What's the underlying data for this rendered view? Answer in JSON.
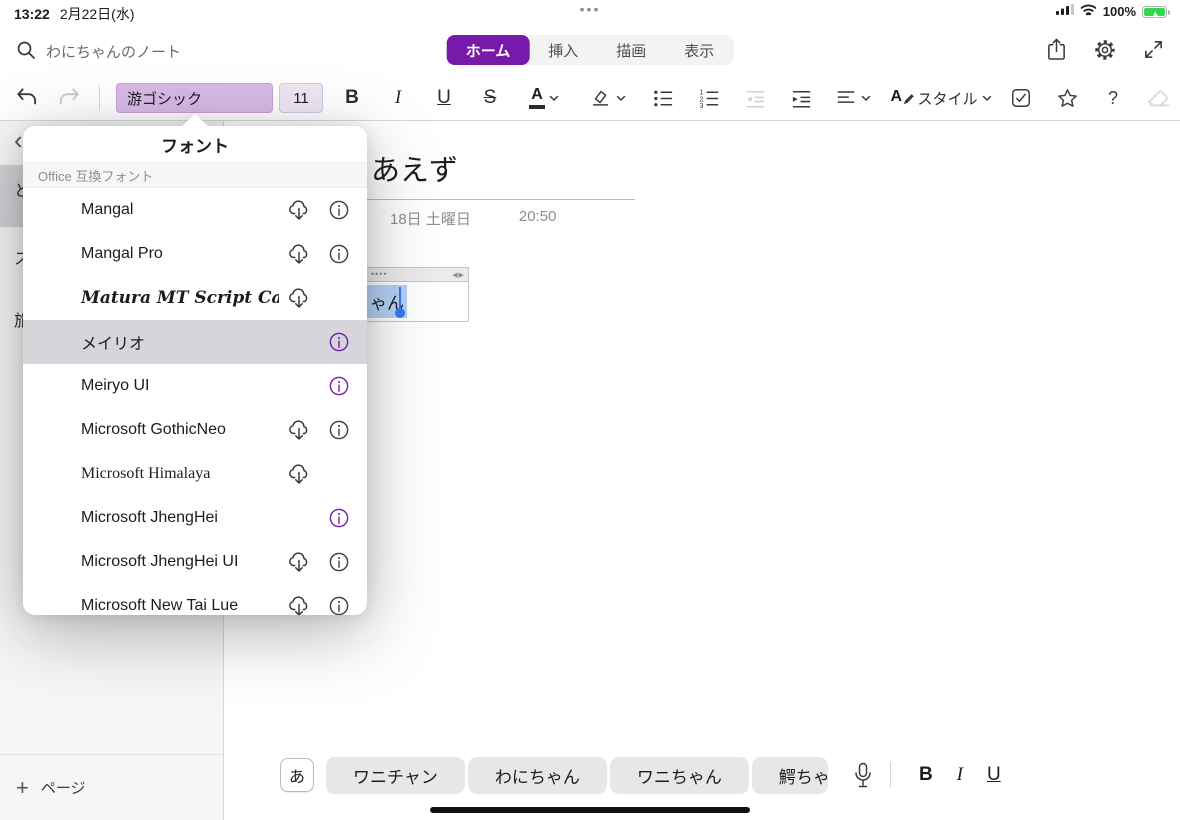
{
  "colors": {
    "accent": "#7719aa",
    "selection_blue": "#3478f6",
    "battery_green": "#32d74b"
  },
  "status_bar": {
    "time": "13:22",
    "date": "2月22日(水)",
    "dots": "•••",
    "battery_percent": "100%"
  },
  "top_bar": {
    "notebook_name": "わにちゃんのノート",
    "tabs": [
      {
        "label": "ホーム",
        "active": true
      },
      {
        "label": "挿入",
        "active": false
      },
      {
        "label": "描画",
        "active": false
      },
      {
        "label": "表示",
        "active": false
      }
    ]
  },
  "ribbon": {
    "font_name": "游ゴシック",
    "font_size": "11",
    "bold_label": "B",
    "italic_label": "I",
    "underline_label": "U",
    "strikethrough_label": "S",
    "font_color_letter": "A",
    "styles_letter": "A",
    "styles_label": "スタイル",
    "help_label": "?"
  },
  "font_popover": {
    "title": "フォント",
    "section_header": "Office 互換フォント",
    "fonts": [
      {
        "name": "Mangal",
        "cloud": true,
        "info": "gray",
        "style": "sans",
        "selected": false
      },
      {
        "name": "Mangal Pro",
        "cloud": true,
        "info": "gray",
        "style": "sans",
        "selected": false
      },
      {
        "name": "Matura MT Script Capitals",
        "cloud": true,
        "info": "none",
        "style": "script",
        "selected": false
      },
      {
        "name": "メイリオ",
        "cloud": false,
        "info": "purple",
        "style": "sans",
        "selected": true
      },
      {
        "name": "Meiryo UI",
        "cloud": false,
        "info": "purple",
        "style": "sans",
        "selected": false
      },
      {
        "name": "Microsoft GothicNeo",
        "cloud": true,
        "info": "gray",
        "style": "sans",
        "selected": false
      },
      {
        "name": "Microsoft Himalaya",
        "cloud": true,
        "info": "none",
        "style": "serif",
        "selected": false
      },
      {
        "name": "Microsoft JhengHei",
        "cloud": false,
        "info": "purple",
        "style": "sans",
        "selected": false
      },
      {
        "name": "Microsoft JhengHei UI",
        "cloud": true,
        "info": "gray",
        "style": "sans",
        "selected": false
      },
      {
        "name": "Microsoft New Tai Lue",
        "cloud": true,
        "info": "gray",
        "style": "sans",
        "selected": false
      }
    ]
  },
  "page": {
    "title_fragment": "あえず",
    "date_text": "18日 土曜日",
    "time_text": "20:50",
    "table": {
      "dots": "••••",
      "arrows": "◀▶",
      "cell_text": "ゃん"
    }
  },
  "sidebar": {
    "back": "‹",
    "items": [
      {
        "label": "と",
        "selected": true
      },
      {
        "label": "ス",
        "selected": false
      },
      {
        "label": "旅",
        "selected": false
      }
    ],
    "add_plus": "+",
    "add_label": "ページ"
  },
  "keyboard_bar": {
    "lang_key": "あ",
    "suggestions": [
      "ワニチャン",
      "わにちゃん",
      "ワニちゃん",
      "鰐ちゃ"
    ],
    "bold": "B",
    "italic": "I",
    "underline": "U"
  }
}
